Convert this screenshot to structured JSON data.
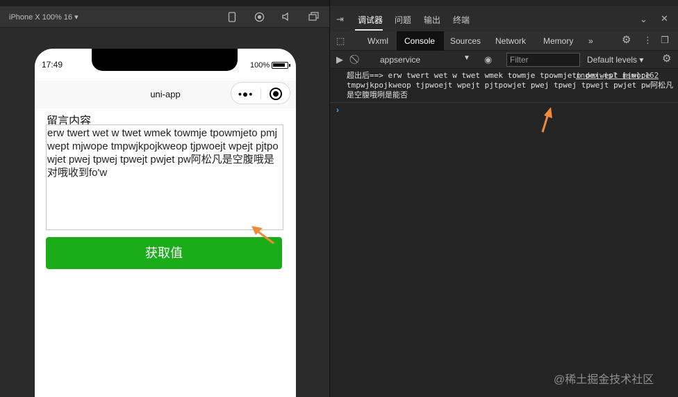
{
  "simulator": {
    "device_label": "iPhone X 100% 16 ▾",
    "status": {
      "time": "17:49",
      "battery": "100%"
    },
    "navbar": {
      "title": "uni-app",
      "capsule_dots": "•●•"
    },
    "form": {
      "label": "留言内容",
      "textarea_value": "erw twert wet w twet wmek towmje tpowmjeto pmjwept mjwope tmpwjkpojkweop tjpwoejt wpejt pjtpowjet pwej tpwej tpwejt pwjet pw阿松凡是空腹哦是对哦收到fo'w",
      "button_label": "获取值"
    }
  },
  "devtools": {
    "top_tabs": [
      "调试器",
      "问题",
      "输出",
      "终端"
    ],
    "panels": [
      "Wxml",
      "Console",
      "Sources",
      "Network",
      "Memory"
    ],
    "panels_more": "»",
    "context": "appservice",
    "filter_placeholder": "Filter",
    "levels": "Default levels ▾",
    "log": {
      "message": "超出后==> erw twert wet w twet wmek towmje tpowmjeto pmjwept mjwope tmpwjkpojkweop tjpwoejt wpejt pjtpowjet pwej tpwej tpwejt pwjet pw阿松凡是空腹哦咧是能否",
      "source": "index.js? [sm]:162"
    },
    "prompt": "›"
  },
  "watermark": "@稀土掘金技术社区",
  "colors": {
    "button_green": "#1aad19",
    "arrow_orange": "#f08a3a",
    "prompt_blue": "#4aa3ff"
  }
}
